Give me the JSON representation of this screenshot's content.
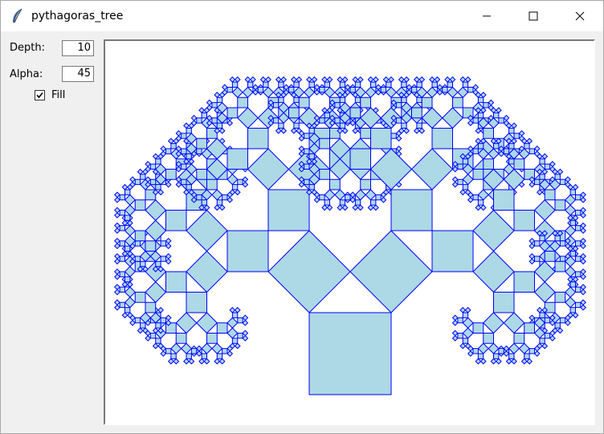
{
  "window": {
    "title": "pythagoras_tree",
    "icons": {
      "app": "feather-icon",
      "minimize": "minimize-icon",
      "maximize": "maximize-icon",
      "close": "close-icon"
    }
  },
  "controls": {
    "depth_label": "Depth:",
    "depth_value": "10",
    "alpha_label": "Alpha:",
    "alpha_value": "45",
    "fill_label": "Fill",
    "fill_checked": true
  },
  "colors": {
    "square_fill": "#add8e6",
    "square_outline": "#0000ff",
    "canvas_bg": "#ffffff"
  }
}
